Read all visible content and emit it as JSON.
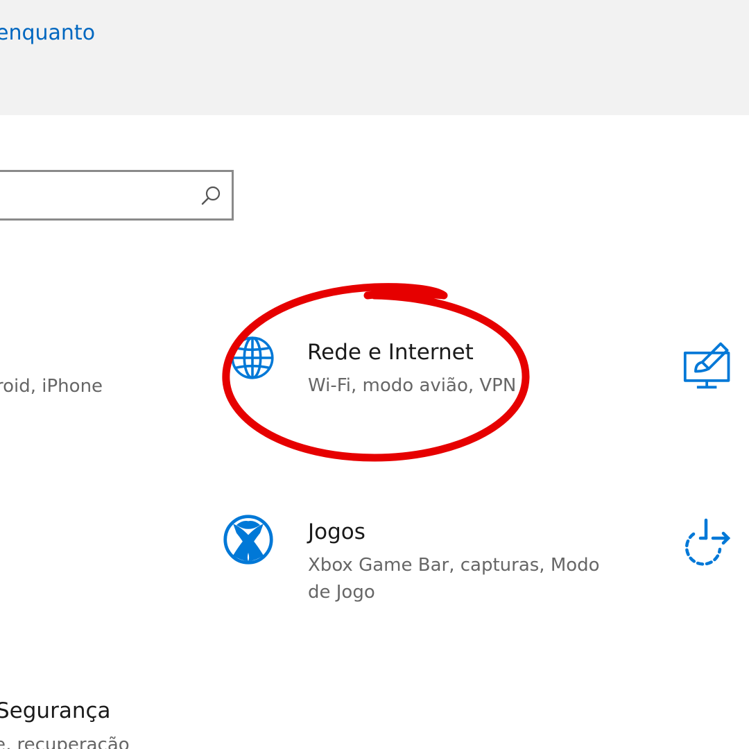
{
  "banner": {
    "link_text": "enquanto"
  },
  "search": {
    "placeholder": "",
    "value": ""
  },
  "tiles": {
    "phone": {
      "desc": "roid, iPhone"
    },
    "network": {
      "title": "Rede e Internet",
      "desc": "Wi-Fi, modo avião, VPN",
      "icon": "globe-icon"
    },
    "personalization": {
      "icon": "personalization-icon"
    },
    "gaming": {
      "title": "Jogos",
      "desc_line1": "Xbox Game Bar, capturas, Modo",
      "desc_line2": "de Jogo",
      "icon": "xbox-icon"
    },
    "update": {
      "icon": "update-sync-icon"
    },
    "security": {
      "title": "Segurança",
      "desc": "e, recuperação"
    }
  },
  "colors": {
    "accent": "#0067c0",
    "icon_blue": "#0078d7",
    "annotation_red": "#e60000",
    "banner_bg": "#f2f2f2"
  }
}
